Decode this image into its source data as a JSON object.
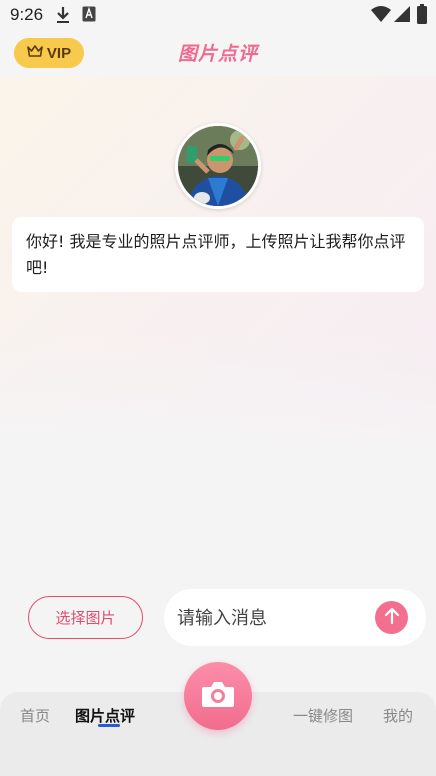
{
  "status_bar": {
    "time": "9:26",
    "icons": [
      "download-icon",
      "a-letter-icon",
      "wifi-icon",
      "signal-icon",
      "battery-icon"
    ]
  },
  "header": {
    "vip_label": "VIP",
    "title": "图片点评"
  },
  "chat": {
    "greeting": "你好! 我是专业的照片点评师，上传照片让我帮你点评吧!"
  },
  "input_area": {
    "select_image_label": "选择图片",
    "message_placeholder": "请输入消息"
  },
  "bottom_nav": {
    "items": [
      {
        "label": "首页",
        "active": false
      },
      {
        "label": "图片点评",
        "active": true
      },
      {
        "label": "一键修图",
        "active": false
      },
      {
        "label": "我的",
        "active": false
      }
    ]
  },
  "colors": {
    "accent_pink": "#f26f8d",
    "vip_gold": "#f7c94d",
    "active_underline": "#2a5bd7"
  }
}
